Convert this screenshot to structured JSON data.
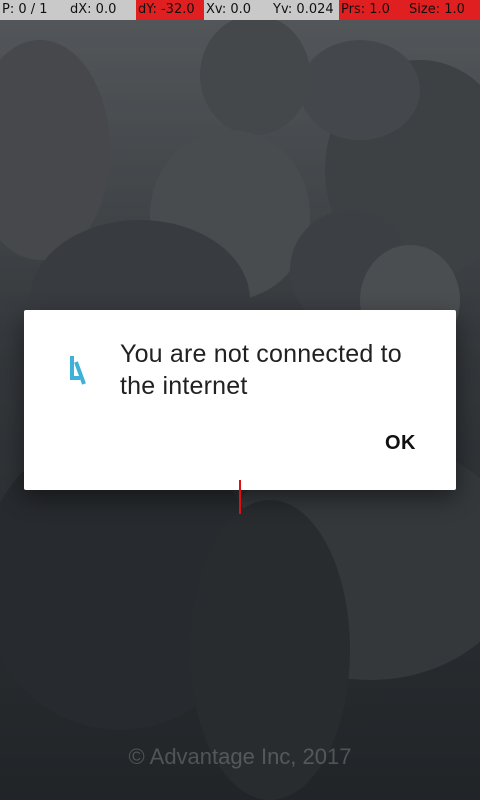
{
  "pointer_location": {
    "p": "P: 0 / 1",
    "dx": "dX: 0.0",
    "dy": "dY: -32.0",
    "xv": "Xv: 0.0",
    "yv": "Yv: 0.024",
    "prs": "Prs: 1.0",
    "size": "Size: 1.0"
  },
  "dialog": {
    "message": "You are not connected to the internet",
    "ok_label": "OK",
    "logo_icon": "advantage-logo-icon",
    "logo_color": "#3fb0d8"
  },
  "footer": {
    "copyright": "© Advantage Inc, 2017"
  },
  "colors": {
    "highlight_red": "#e02020",
    "dialog_bg": "#ffffff"
  }
}
